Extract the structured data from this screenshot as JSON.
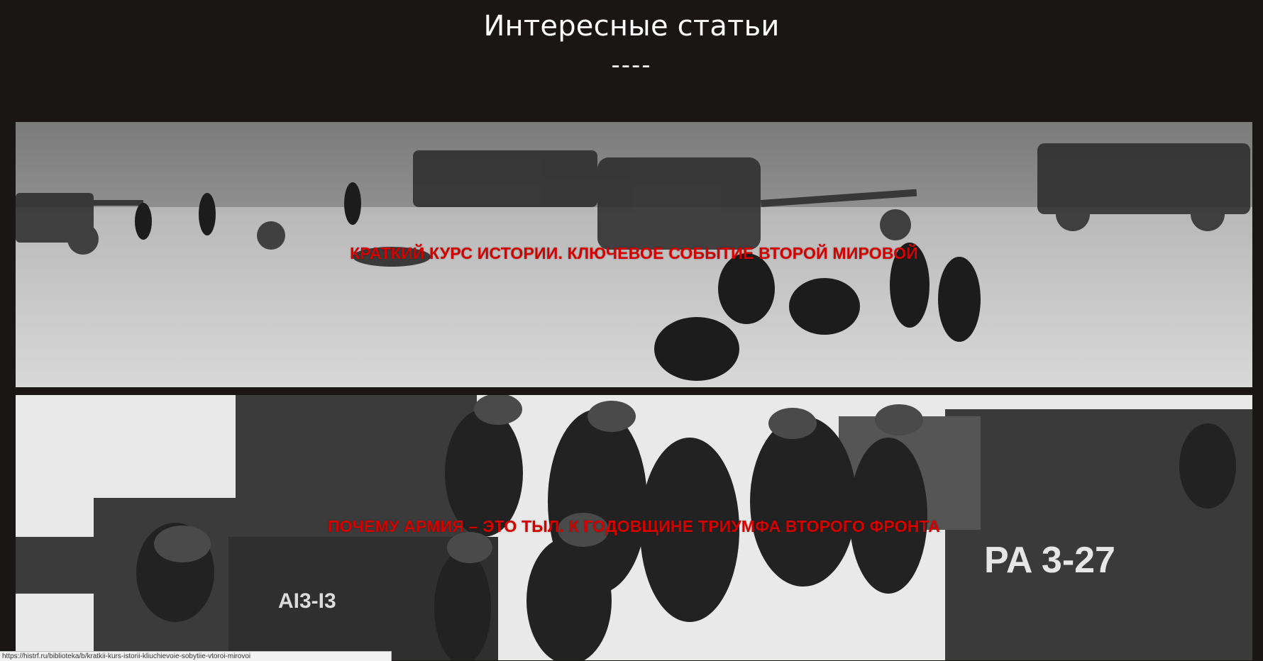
{
  "section": {
    "title": "Интересные статьи",
    "divider": "----"
  },
  "articles": [
    {
      "title": "КРАТКИЙ КУРС ИСТОРИИ. КЛЮЧЕВОЕ СОБЫТИЕ ВТОРОЙ МИРОВОЙ",
      "image_icon": "photo-beach-landing-vehicles"
    },
    {
      "title": "ПОЧЕМУ АРМИЯ – ЭТО ТЫЛ. К ГОДОВЩИНЕ ТРИУМФА ВТОРОГО ФРОНТА",
      "image_icon": "photo-soldiers-landing-craft",
      "hull_marking_left": "AI3-I3",
      "hull_marking_right": "PA 3-27"
    }
  ],
  "status_bar": {
    "url": "https://histrf.ru/biblioteka/b/kratkii-kurs-istorii-kliuchievoie-sobytiie-vtoroi-mirovoi"
  },
  "colors": {
    "background": "#1a1616",
    "title_text": "#ffffff",
    "article_title": "#d40000"
  }
}
